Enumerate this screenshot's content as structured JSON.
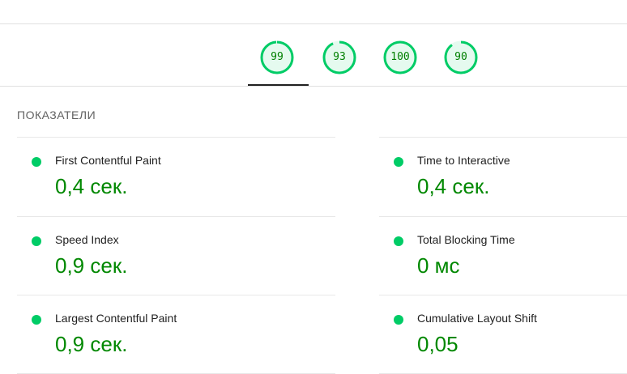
{
  "scores": [
    {
      "label": "99",
      "value": 99
    },
    {
      "label": "93",
      "value": 93
    },
    {
      "label": "100",
      "value": 100
    },
    {
      "label": "90",
      "value": 90
    }
  ],
  "colors": {
    "pass": "#00cc66",
    "pass_text": "#008800",
    "pass_fill": "#e5faef"
  },
  "section_title": "ПОКАЗАТЕЛИ",
  "metrics": [
    {
      "title": "First Contentful Paint",
      "value": "0,4 сек."
    },
    {
      "title": "Time to Interactive",
      "value": "0,4 сек."
    },
    {
      "title": "Speed Index",
      "value": "0,9 сек."
    },
    {
      "title": "Total Blocking Time",
      "value": "0 мс"
    },
    {
      "title": "Largest Contentful Paint",
      "value": "0,9 сек."
    },
    {
      "title": "Cumulative Layout Shift",
      "value": "0,05"
    }
  ]
}
